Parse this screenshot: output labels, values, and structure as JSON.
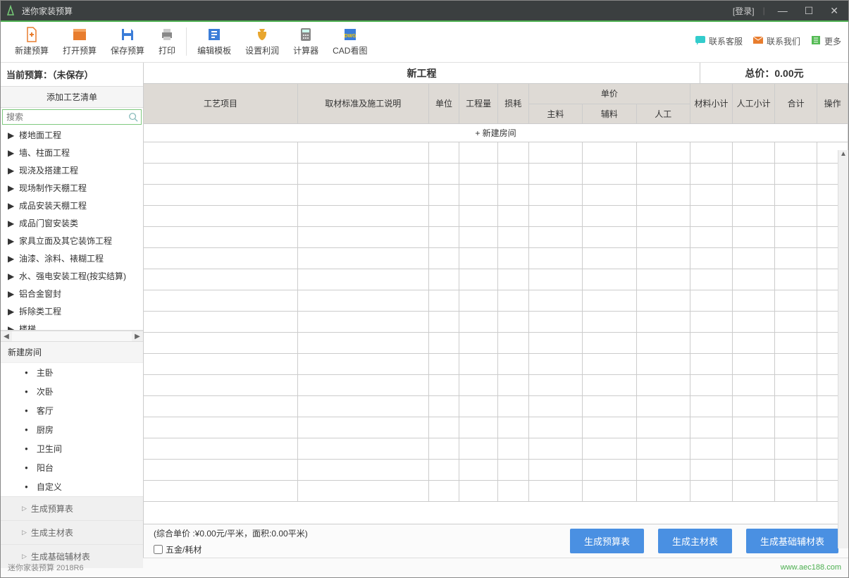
{
  "titlebar": {
    "title": "迷你家装预算",
    "login": "[登录]"
  },
  "toolbar": {
    "new": "新建预算",
    "open": "打开预算",
    "save": "保存预算",
    "print": "打印",
    "edit_tpl": "编辑模板",
    "set_profit": "设置利润",
    "calculator": "计算器",
    "cad": "CAD看图",
    "contact_cs": "联系客服",
    "contact_us": "联系我们",
    "more": "更多"
  },
  "sidebar": {
    "current_budget": "当前预算：（未保存）",
    "add_list_header": "添加工艺清单",
    "search_placeholder": "搜索",
    "tree": [
      "楼地面工程",
      "墙、柱面工程",
      "现浇及搭建工程",
      "现场制作天棚工程",
      "成品安装天棚工程",
      "成品门窗安装类",
      "家具立面及其它装饰工程",
      "油漆、涂料、裱糊工程",
      "水、强电安装工程(按实结算)",
      "铝合金窗封",
      "拆除类工程",
      "楼梯"
    ],
    "room_header": "新建房间",
    "rooms": [
      "主卧",
      "次卧",
      "客厅",
      "厨房",
      "卫生间",
      "阳台",
      "自定义"
    ],
    "gen_budget": "生成预算表",
    "gen_material": "生成主材表",
    "gen_aux": "生成基础辅材表"
  },
  "main": {
    "project_title": "新工程",
    "total_label": "总价：0.00元",
    "headers": {
      "project": "工艺项目",
      "desc": "取材标准及施工说明",
      "unit": "单位",
      "qty": "工程量",
      "loss": "损耗",
      "price_group": "单价",
      "main_mat": "主料",
      "aux_mat": "辅料",
      "labor": "人工",
      "mat_sub": "材料小计",
      "lab_sub": "人工小计",
      "sum": "合计",
      "op": "操作"
    },
    "new_room_row": "+ 新建房间",
    "summary_text": "(综合单价 :¥0.00元/平米，面积:0.00平米)",
    "hardware_label": "五金/耗材",
    "btn_gen_budget": "生成预算表",
    "btn_gen_material": "生成主材表",
    "btn_gen_aux": "生成基础辅材表"
  },
  "status": {
    "version": "迷你家装预算 2018R6",
    "url": "www.aec188.com"
  }
}
